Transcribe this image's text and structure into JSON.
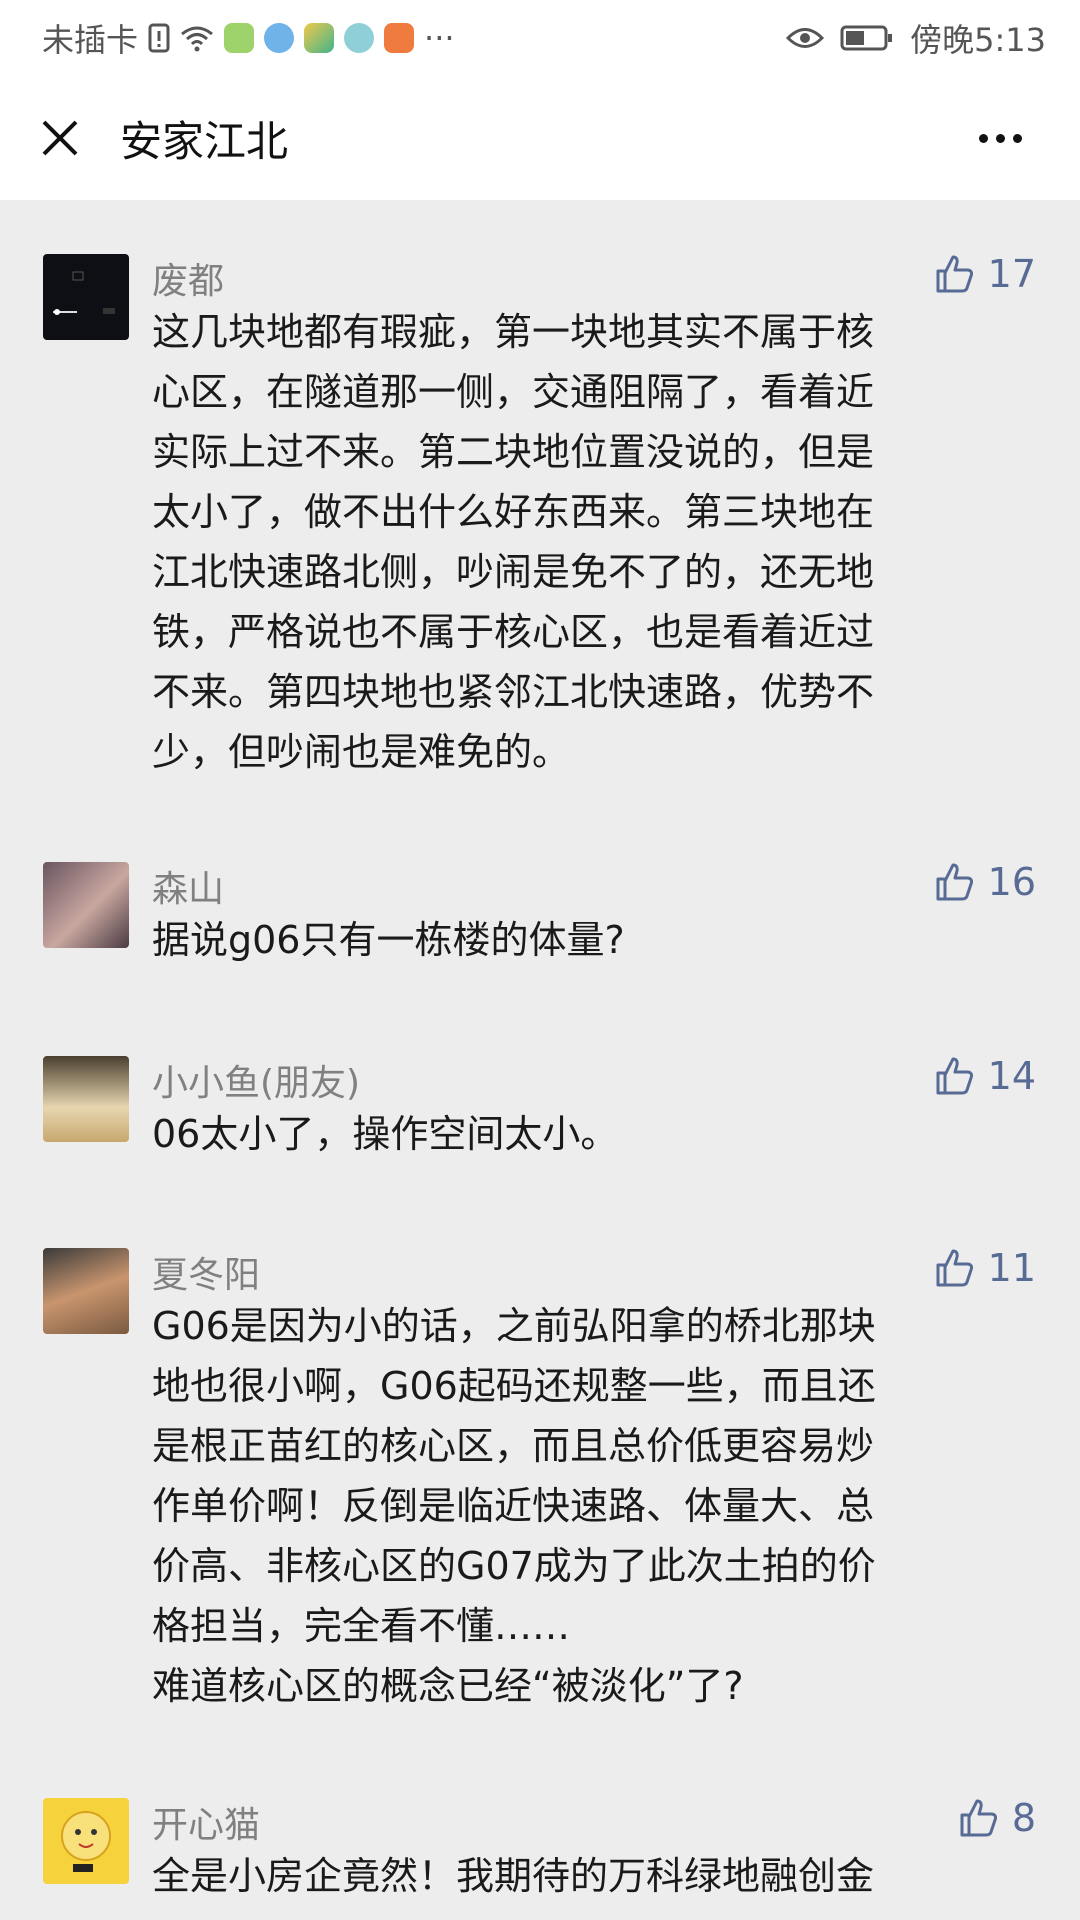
{
  "status_bar": {
    "carrier": "未插卡",
    "time": "傍晚5:13",
    "more": "···"
  },
  "nav": {
    "title": "安家江北"
  },
  "comments": [
    {
      "name": "废都",
      "likes": "17",
      "lines": [
        "这几块地都有瑕疵，第一块地其实不属于核",
        "心区，在隧道那一侧，交通阻隔了，看着近",
        "实际上过不来。第二块地位置没说的，但是",
        "太小了，做不出什么好东西来。第三块地在",
        "江北快速路北侧，吵闹是免不了的，还无地",
        "铁，严格说也不属于核心区，也是看着近过",
        "不来。第四块地也紧邻江北快速路，优势不",
        "少，但吵闹也是难免的。"
      ]
    },
    {
      "name": "森山",
      "likes": "16",
      "lines": [
        "据说g06只有一栋楼的体量?"
      ]
    },
    {
      "name": "小小鱼(朋友)",
      "likes": "14",
      "lines": [
        "06太小了，操作空间太小。"
      ]
    },
    {
      "name": "夏冬阳",
      "likes": "11",
      "lines": [
        "G06是因为小的话，之前弘阳拿的桥北那块",
        "地也很小啊，G06起码还规整一些，而且还",
        "是根正苗红的核心区，而且总价低更容易炒",
        "作单价啊！反倒是临近快速路、体量大、总",
        "价高、非核心区的G07成为了此次土拍的价",
        "格担当，完全看不懂……",
        "难道核心区的概念已经“被淡化”了?"
      ]
    },
    {
      "name": "开心猫",
      "likes": "8",
      "lines": [
        "全是小房企竟然！我期待的万科绿地融创金"
      ]
    }
  ]
}
